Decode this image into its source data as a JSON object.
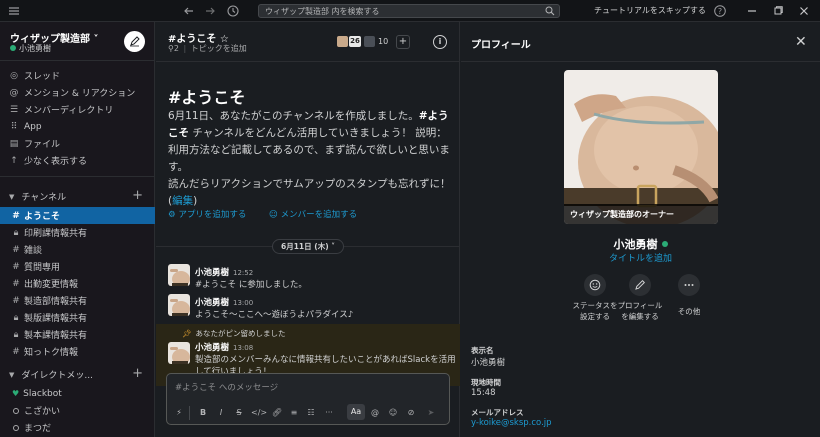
{
  "colors": {
    "accent": "#1164a3",
    "link": "#1d9bd1",
    "online": "#2bac76",
    "pinned_bg": "#2a2616"
  },
  "titlebar": {
    "search_placeholder": "ウィザップ製造部 内を検索する",
    "tutorial_label": "チュートリアルをスキップする",
    "icons": [
      "menu-icon",
      "back-arrow-icon",
      "forward-arrow-icon",
      "history-icon",
      "help-icon",
      "minimize-icon",
      "maximize-icon",
      "close-icon"
    ]
  },
  "workspace": {
    "name": "ウィザップ製造部 ˅",
    "user": "小池勇樹"
  },
  "nav": [
    {
      "label": "スレッド",
      "icon": "threads-icon"
    },
    {
      "label": "メンション & リアクション",
      "icon": "at-icon"
    },
    {
      "label": "メンバーディレクトリ",
      "icon": "directory-icon"
    },
    {
      "label": "App",
      "icon": "apps-icon"
    },
    {
      "label": "ファイル",
      "icon": "files-icon"
    },
    {
      "label": "少なく表示する",
      "icon": "arrow-up-icon"
    }
  ],
  "channels_section": {
    "label": "チャンネル"
  },
  "channels": [
    {
      "name": "ようこそ",
      "active": true
    },
    {
      "name": "印刷課情報共有",
      "private": true
    },
    {
      "name": "雑談"
    },
    {
      "name": "質問専用"
    },
    {
      "name": "出勤変更情報"
    },
    {
      "name": "製造部情報共有"
    },
    {
      "name": "製版課情報共有",
      "private": true
    },
    {
      "name": "製本課情報共有",
      "private": true
    },
    {
      "name": "知っトク情報"
    }
  ],
  "dm_section": {
    "label": "ダイレクトメッ..."
  },
  "dms": [
    {
      "name": "Slackbot"
    },
    {
      "name": "こざかい"
    },
    {
      "name": "まつだ"
    }
  ],
  "channel": {
    "title": "#ようこそ ☆",
    "pin_count": "2",
    "add_topic": "トピックを追加",
    "member_count_badge": "26",
    "member_count": "10",
    "intro_title": "#ようこそ",
    "intro_part1": "6月11日、あなたがこのチャンネルを作成しました。",
    "intro_bold": "#ようこそ",
    "intro_part2": " チャンネルをどんどん活用していきましょう！ 説明：利用方法など記載してあるので、まず読んで欲しいと思います。",
    "intro_part3": "読んだらリアクションでサムアップのスタンプも忘れずに！ (",
    "intro_edit": "編集",
    "intro_part4": ")",
    "add_app": "アプリを追加する",
    "add_member": "メンバーを追加する",
    "date_pill": "6月11日 (木) ˅"
  },
  "messages": [
    {
      "author": "小池勇樹",
      "time": "12:52",
      "text": "#ようこそ に参加しました。"
    },
    {
      "author": "小池勇樹",
      "time": "13:00",
      "text": "ようこそ〜ここへ〜遊ぼうよパラダイス♪"
    },
    {
      "author": "小池勇樹",
      "time": "13:08",
      "text": "製造部のメンバーみんなに情報共有したいことがあればSlackを活用",
      "text2": "して行いましょう！"
    }
  ],
  "pinned_note": "あなたがピン留めしました",
  "composer": {
    "placeholder": "#ようこそ へのメッセージ",
    "aa": "Aa"
  },
  "profile": {
    "header": "プロフィール",
    "photo_caption": "ウィザップ製造部のオーナー",
    "name": "小池勇樹",
    "add_title": "タイトルを追加",
    "actions": [
      {
        "label1": "ステータスを",
        "label2": "設定する"
      },
      {
        "label1": "プロフィール",
        "label2": "を編集する"
      },
      {
        "label1": "その他",
        "label2": ""
      }
    ],
    "fields": [
      {
        "label": "表示名",
        "value": "小池勇樹"
      },
      {
        "label": "現地時間",
        "value": "15:48"
      },
      {
        "label": "メールアドレス",
        "value": "y-koike@sksp.co.jp"
      }
    ]
  }
}
